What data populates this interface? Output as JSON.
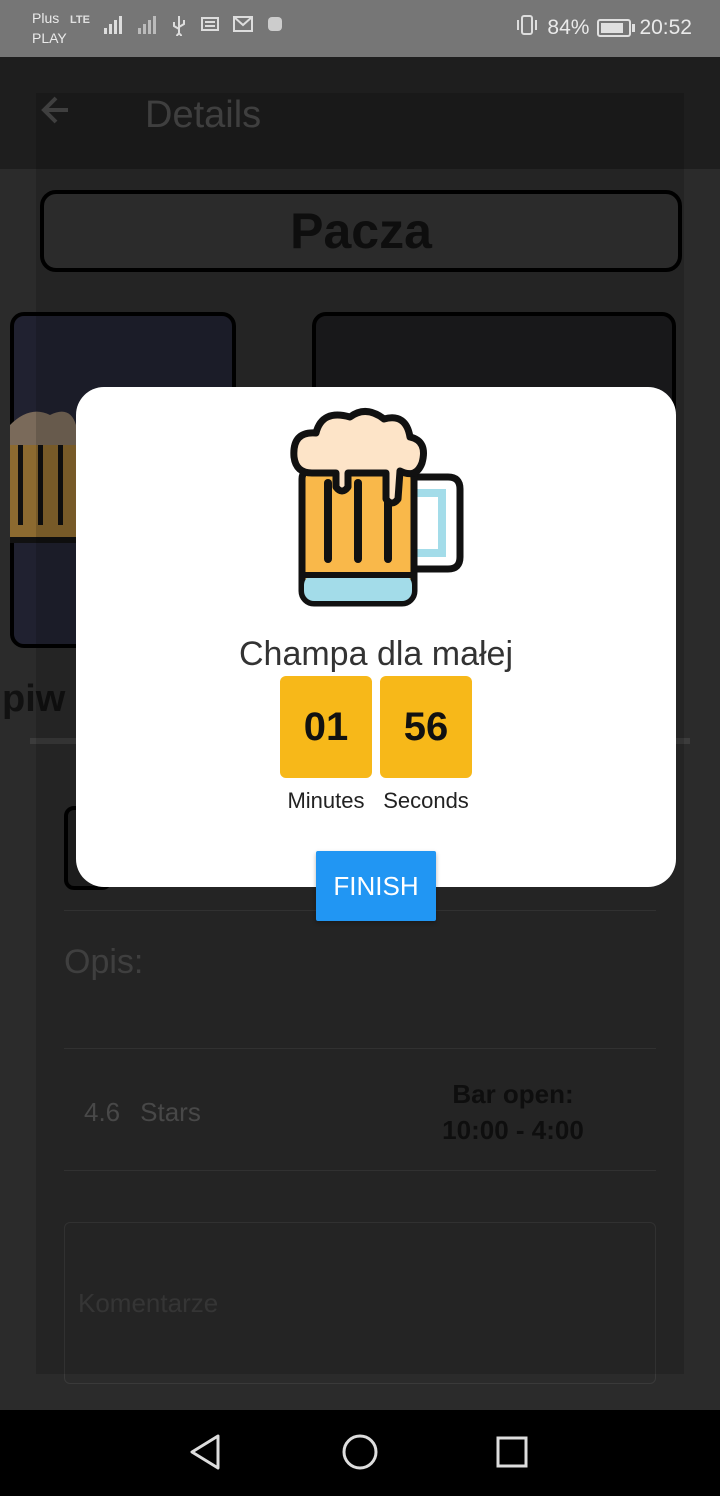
{
  "status_bar": {
    "carrier_line1": "Plus",
    "carrier_line2": "PLAY",
    "network": "LTE",
    "battery_percent": "84%",
    "battery_level": 0.84,
    "time": "20:52"
  },
  "app_bar": {
    "title": "Details"
  },
  "bar": {
    "name": "Pacza",
    "section_partial": "piw",
    "description_label": "Opis:",
    "rating_value": "4.6",
    "rating_unit": "Stars",
    "open_label": "Bar open:",
    "open_hours": "10:00 - 4:00",
    "comments_placeholder": "Komentarze"
  },
  "dialog": {
    "drink_name": "Champa dla małej",
    "timer": {
      "minutes": "01",
      "seconds": "56",
      "minutes_label": "Minutes",
      "seconds_label": "Seconds"
    },
    "finish_label": "FINISH",
    "icon": "beer-mug-icon"
  },
  "colors": {
    "timer_box": "#f7b819",
    "finish_button": "#2196f3",
    "beer": "#f9b84a",
    "foam": "#fde4c8",
    "glass": "#a3dce9"
  }
}
